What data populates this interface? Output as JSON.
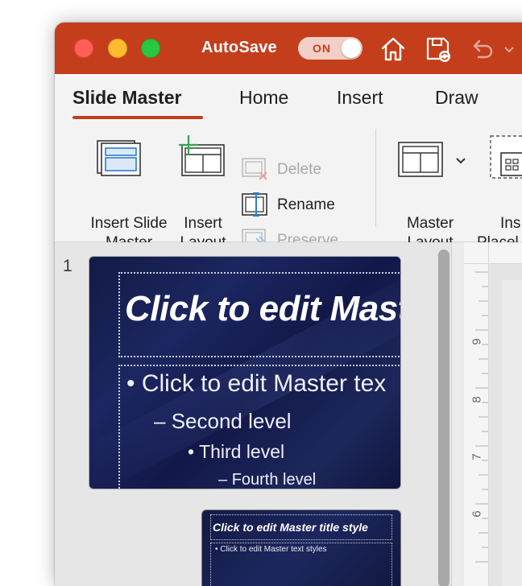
{
  "titlebar": {
    "autosave_label": "AutoSave",
    "autosave_state": "ON",
    "accent_color": "#c43e1c",
    "icons": [
      "home-icon",
      "save-icon",
      "undo-icon",
      "chevron-down-icon"
    ]
  },
  "tabs": [
    {
      "label": "Slide Master",
      "active": true
    },
    {
      "label": "Home",
      "active": false
    },
    {
      "label": "Insert",
      "active": false
    },
    {
      "label": "Draw",
      "active": false
    }
  ],
  "ribbon": {
    "insert_slide_master": [
      "Insert Slide",
      "Master"
    ],
    "insert_layout": [
      "Insert",
      "Layout"
    ],
    "delete": "Delete",
    "rename": "Rename",
    "preserve": "Preserve",
    "master_layout": [
      "Master",
      "Layout"
    ],
    "insert_placeholder": [
      "Ins",
      "Placel"
    ]
  },
  "thumbnails": {
    "slide_number": "1",
    "master": {
      "title": "Click to edit Maste",
      "levels": [
        "Click to edit Master tex",
        "Second level",
        "Third level",
        "Fourth level"
      ]
    },
    "layout": {
      "title": "Click to edit Master title style",
      "text": "Click to edit Master text styles"
    }
  },
  "ruler": {
    "marks": [
      "9",
      "8",
      "7",
      "6"
    ]
  }
}
